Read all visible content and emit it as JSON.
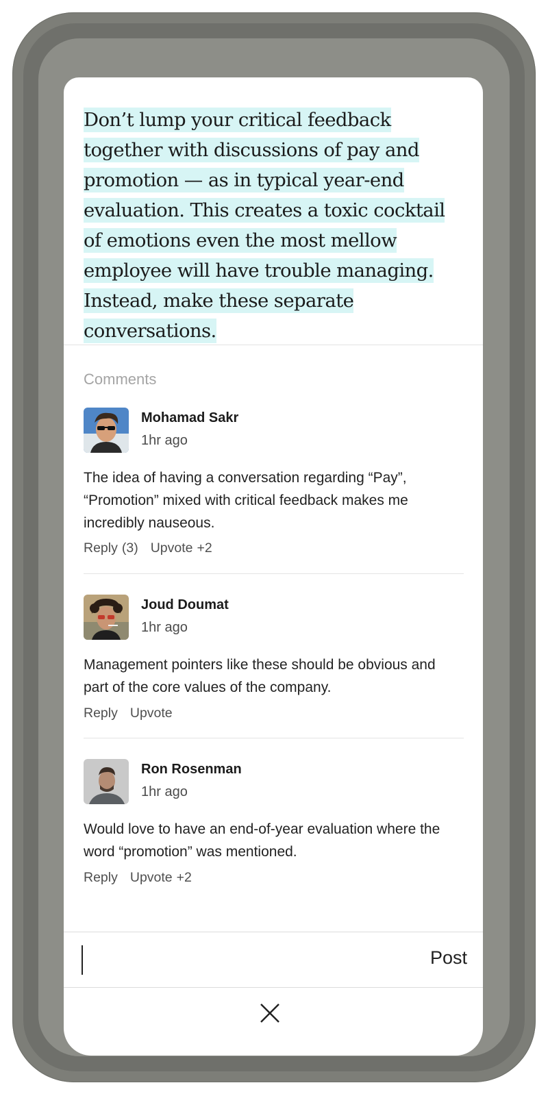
{
  "article": {
    "quote": "Don’t lump your critical feedback together with discussions of pay and promotion — as in typical year-end evaluation. This creates a toxic cocktail of emotions even the most mellow employee will have trouble managing. Instead, make these separate conversations."
  },
  "comments": {
    "label": "Comments",
    "items": [
      {
        "author": "Mohamad Sakr",
        "time": "1hr ago",
        "text": "The idea of having a conversation regarding “Pay”, “Promotion” mixed with critical feedback makes me incredibly nauseous.",
        "reply_label": "Reply",
        "reply_count": "(3)",
        "upvote_label": "Upvote",
        "upvote_count": "+2"
      },
      {
        "author": "Joud Doumat",
        "time": "1hr ago",
        "text": "Management pointers like these should be obvious and part of the core values of the company.",
        "reply_label": "Reply",
        "upvote_label": "Upvote"
      },
      {
        "author": "Ron Rosenman",
        "time": "1hr ago",
        "text": "Would love to have an end-of-year evaluation where the word “promotion” was mentioned.",
        "reply_label": "Reply",
        "upvote_label": "Upvote",
        "upvote_count": "+2"
      }
    ]
  },
  "composer": {
    "post_label": "Post",
    "value": ""
  },
  "icons": {
    "close": "close-icon",
    "avatar": "avatar"
  },
  "colors": {
    "highlight": "#d7f5f5",
    "device": "#7d7e78"
  }
}
